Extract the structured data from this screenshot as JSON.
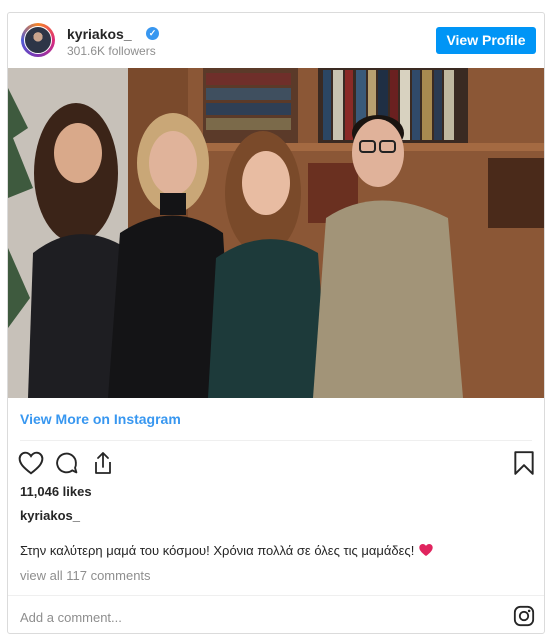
{
  "profile": {
    "username": "kyriakos_",
    "followers": "301.6K followers",
    "view_profile_label": "View Profile"
  },
  "post": {
    "view_more_label": "View More on Instagram",
    "likes": "11,046 likes",
    "caption_user": "kyriakos_",
    "caption_text": "Στην καλύτερη μαμά του κόσμου! Χρόνια πολλά σε όλες τις μαμάδες!",
    "comments_link": "view all 117 comments",
    "add_comment_placeholder": "Add a comment..."
  },
  "colors": {
    "accent": "#0095f6",
    "link": "#3897f0",
    "muted": "#8e8e8e",
    "heart": "#e0245e"
  },
  "icons": [
    "verified-badge-icon",
    "heart-icon",
    "comment-icon",
    "share-icon",
    "bookmark-icon",
    "instagram-icon",
    "red-heart-emoji-icon"
  ]
}
